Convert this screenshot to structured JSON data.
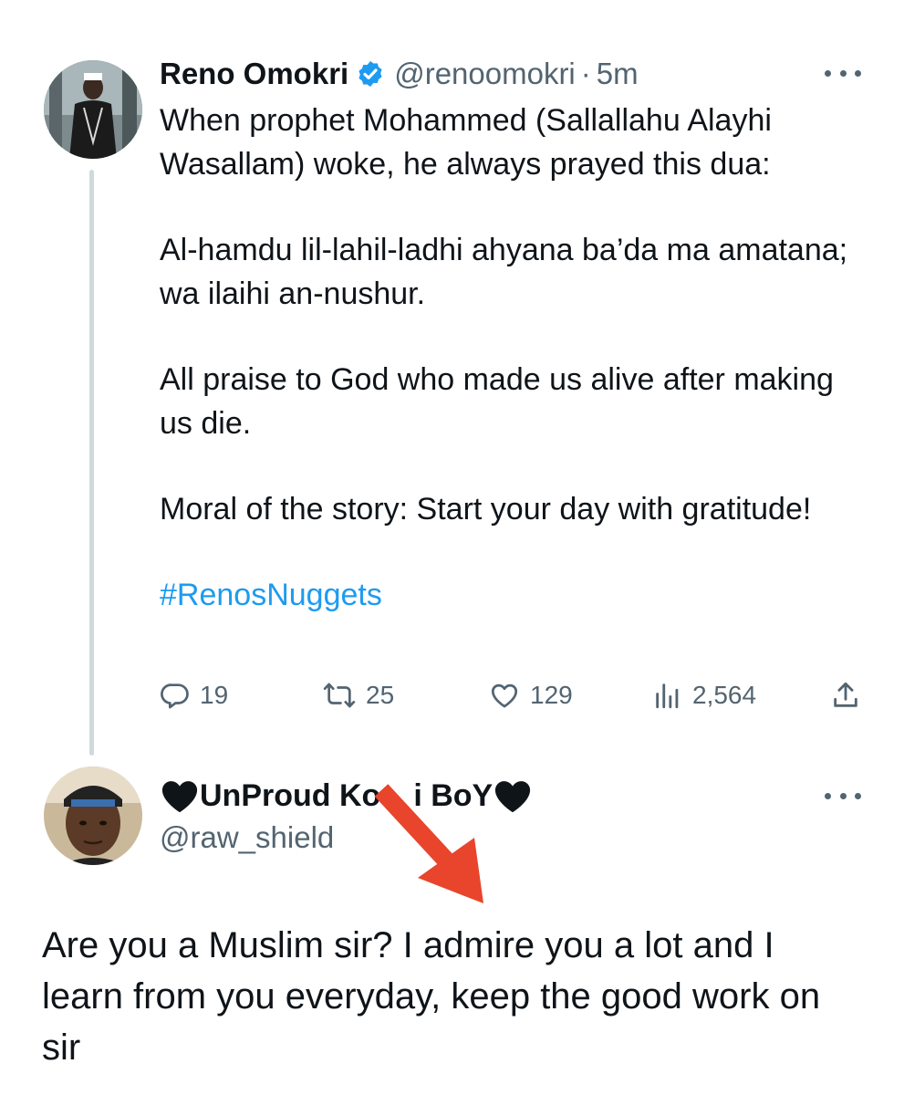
{
  "tweet": {
    "display_name": "Reno Omokri",
    "handle": "@renoomokri",
    "separator": "·",
    "time": "5m",
    "avatar_icon": "profile-photo-icon",
    "verified_icon": "verified-badge-icon",
    "paragraphs": [
      "When prophet Mohammed (Sallallahu Alayhi Wasallam) woke, he always prayed this dua:",
      "Al-hamdu lil-lahil-ladhi ahyana ba’da ma amatana; wa ilaihi an-nushur.",
      "All praise to God who made us alive after making us die.",
      "Moral of the story: Start your day with gratitude!"
    ],
    "hashtag": "#RenosNuggets",
    "actions": {
      "replies": "19",
      "retweets": "25",
      "likes": "129",
      "views": "2,564"
    }
  },
  "reply": {
    "display_name": "UnProud Ko",
    "display_name_tail": "i BoY",
    "handle": "@raw_shield",
    "text": "Are you a Muslim sir? I admire you a lot and I learn from you everyday, keep the good work on sir",
    "heart_icon": "black-heart-icon"
  },
  "colors": {
    "accent": "#1d9bf0",
    "muted": "#536471",
    "text": "#0f1419",
    "thread_line": "#cfd9de",
    "annotation_arrow": "#e8452c"
  }
}
